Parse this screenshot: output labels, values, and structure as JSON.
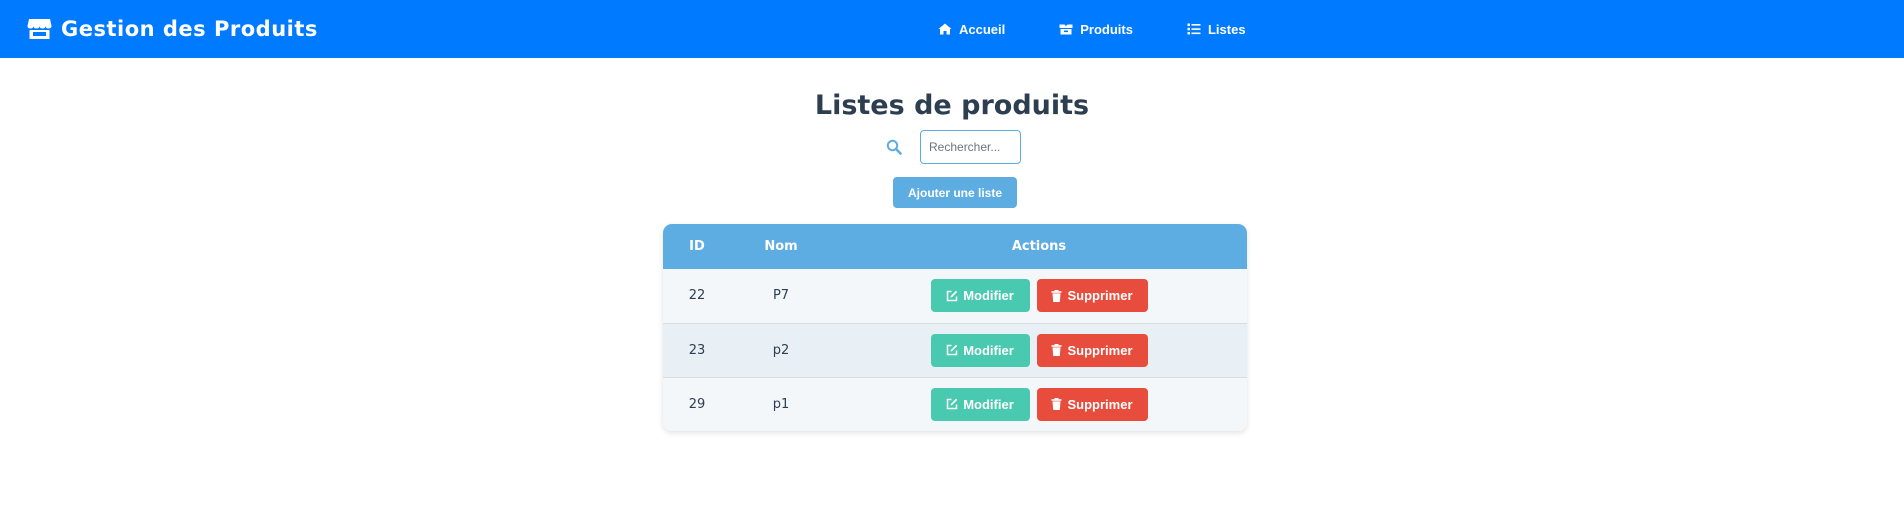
{
  "navbar": {
    "brand": "Gestion des Produits",
    "links": [
      {
        "label": "Accueil",
        "icon": "home-icon"
      },
      {
        "label": "Produits",
        "icon": "box-icon"
      },
      {
        "label": "Listes",
        "icon": "list-icon"
      }
    ]
  },
  "main": {
    "title": "Listes de produits",
    "search": {
      "placeholder": "Rechercher...",
      "value": ""
    },
    "add_button": "Ajouter une liste"
  },
  "table": {
    "headers": [
      "ID",
      "Nom",
      "Actions"
    ],
    "rows": [
      {
        "id": "22",
        "nom": "P7"
      },
      {
        "id": "23",
        "nom": "p2"
      },
      {
        "id": "29",
        "nom": "p1"
      }
    ],
    "edit_label": "Modifier",
    "delete_label": "Supprimer"
  },
  "colors": {
    "navbar": "#007bff",
    "accent": "#5dade2",
    "edit": "#48c9b0",
    "delete": "#e74c3c"
  }
}
